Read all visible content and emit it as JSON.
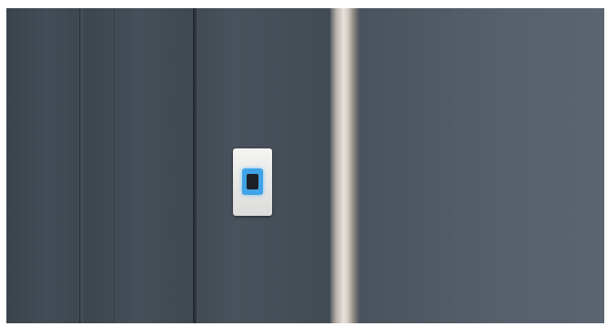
{
  "scene": {
    "colors": {
      "door": "#434c56",
      "wall": "#525c66",
      "frame_strip": "#e7e2dc",
      "reader_body": "#f0f0ee",
      "sensor_glow": "#3fa3e6",
      "sensor": "#1d2127"
    }
  }
}
